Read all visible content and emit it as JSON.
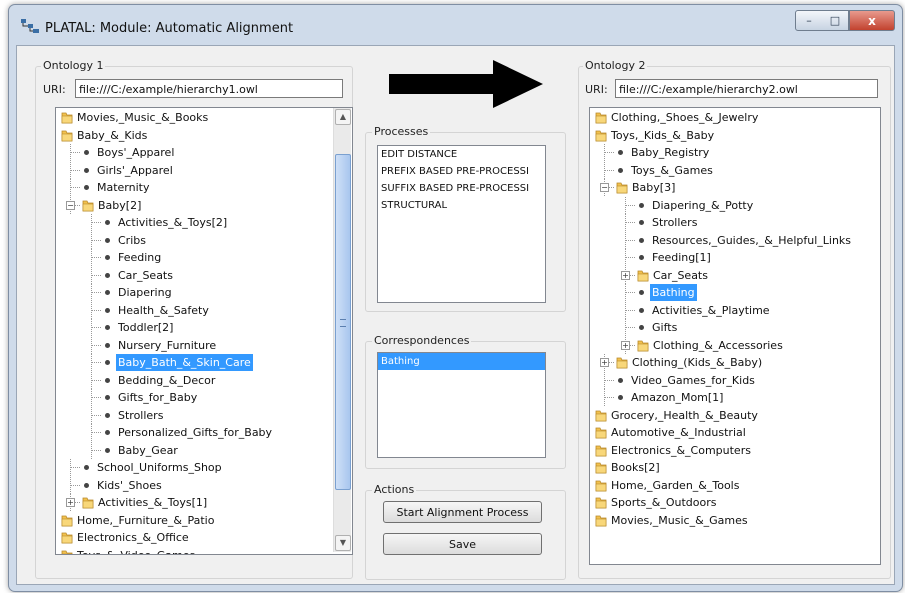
{
  "window": {
    "title": "PLATAL: Module: Automatic Alignment",
    "controls": {
      "minimize": "–",
      "maximize": "□",
      "close": "x"
    }
  },
  "ontology1": {
    "label": "Ontology 1",
    "uri_label": "URI:",
    "uri_value": "file:///C:/example/hierarchy1.owl",
    "tree": [
      {
        "label": "Movies,_Music_&_Books",
        "depth": 0,
        "kind": "folder"
      },
      {
        "label": "Baby_&_Kids",
        "depth": 0,
        "kind": "folder"
      },
      {
        "label": "Boys'_Apparel",
        "depth": 1,
        "kind": "leaf"
      },
      {
        "label": "Girls'_Apparel",
        "depth": 1,
        "kind": "leaf"
      },
      {
        "label": "Maternity",
        "depth": 1,
        "kind": "leaf"
      },
      {
        "label": "Baby[2]",
        "depth": 1,
        "kind": "folder",
        "expander": "−"
      },
      {
        "label": "Activities_&_Toys[2]",
        "depth": 2,
        "kind": "leaf"
      },
      {
        "label": "Cribs",
        "depth": 2,
        "kind": "leaf"
      },
      {
        "label": "Feeding",
        "depth": 2,
        "kind": "leaf"
      },
      {
        "label": "Car_Seats",
        "depth": 2,
        "kind": "leaf"
      },
      {
        "label": "Diapering",
        "depth": 2,
        "kind": "leaf"
      },
      {
        "label": "Health_&_Safety",
        "depth": 2,
        "kind": "leaf"
      },
      {
        "label": "Toddler[2]",
        "depth": 2,
        "kind": "leaf"
      },
      {
        "label": "Nursery_Furniture",
        "depth": 2,
        "kind": "leaf"
      },
      {
        "label": "Baby_Bath_&_Skin_Care",
        "depth": 2,
        "kind": "leaf",
        "selected": true
      },
      {
        "label": "Bedding_&_Decor",
        "depth": 2,
        "kind": "leaf"
      },
      {
        "label": "Gifts_for_Baby",
        "depth": 2,
        "kind": "leaf"
      },
      {
        "label": "Strollers",
        "depth": 2,
        "kind": "leaf"
      },
      {
        "label": "Personalized_Gifts_for_Baby",
        "depth": 2,
        "kind": "leaf"
      },
      {
        "label": "Baby_Gear",
        "depth": 2,
        "kind": "leaf"
      },
      {
        "label": "School_Uniforms_Shop",
        "depth": 1,
        "kind": "leaf"
      },
      {
        "label": "Kids'_Shoes",
        "depth": 1,
        "kind": "leaf"
      },
      {
        "label": "Activities_&_Toys[1]",
        "depth": 1,
        "kind": "folder",
        "expander": "+"
      },
      {
        "label": "Home,_Furniture_&_Patio",
        "depth": 0,
        "kind": "folder"
      },
      {
        "label": "Electronics_&_Office",
        "depth": 0,
        "kind": "folder"
      },
      {
        "label": "Toys_&_Video_Games",
        "depth": 0,
        "kind": "folder"
      }
    ]
  },
  "ontology2": {
    "label": "Ontology 2",
    "uri_label": "URI:",
    "uri_value": "file:///C:/example/hierarchy2.owl",
    "tree": [
      {
        "label": "Clothing,_Shoes_&_Jewelry",
        "depth": 0,
        "kind": "folder"
      },
      {
        "label": "Toys,_Kids_&_Baby",
        "depth": 0,
        "kind": "folder"
      },
      {
        "label": "Baby_Registry",
        "depth": 1,
        "kind": "leaf"
      },
      {
        "label": "Toys_&_Games",
        "depth": 1,
        "kind": "leaf"
      },
      {
        "label": "Baby[3]",
        "depth": 1,
        "kind": "folder",
        "expander": "−"
      },
      {
        "label": "Diapering_&_Potty",
        "depth": 2,
        "kind": "leaf"
      },
      {
        "label": "Strollers",
        "depth": 2,
        "kind": "leaf"
      },
      {
        "label": "Resources,_Guides,_&_Helpful_Links",
        "depth": 2,
        "kind": "leaf"
      },
      {
        "label": "Feeding[1]",
        "depth": 2,
        "kind": "leaf"
      },
      {
        "label": "Car_Seats",
        "depth": 2,
        "kind": "folder",
        "expander": "+"
      },
      {
        "label": "Bathing",
        "depth": 2,
        "kind": "leaf",
        "selected": true
      },
      {
        "label": "Activities_&_Playtime",
        "depth": 2,
        "kind": "leaf"
      },
      {
        "label": "Gifts",
        "depth": 2,
        "kind": "leaf"
      },
      {
        "label": "Clothing_&_Accessories",
        "depth": 2,
        "kind": "folder",
        "expander": "+"
      },
      {
        "label": "Clothing_(Kids_&_Baby)",
        "depth": 1,
        "kind": "folder",
        "expander": "+"
      },
      {
        "label": "Video_Games_for_Kids",
        "depth": 1,
        "kind": "leaf"
      },
      {
        "label": "Amazon_Mom[1]",
        "depth": 1,
        "kind": "leaf"
      },
      {
        "label": "Grocery,_Health_&_Beauty",
        "depth": 0,
        "kind": "folder"
      },
      {
        "label": "Automotive_&_Industrial",
        "depth": 0,
        "kind": "folder"
      },
      {
        "label": "Electronics_&_Computers",
        "depth": 0,
        "kind": "folder"
      },
      {
        "label": "Books[2]",
        "depth": 0,
        "kind": "folder"
      },
      {
        "label": "Home,_Garden_&_Tools",
        "depth": 0,
        "kind": "folder"
      },
      {
        "label": "Sports_&_Outdoors",
        "depth": 0,
        "kind": "folder"
      },
      {
        "label": "Movies,_Music_&_Games",
        "depth": 0,
        "kind": "folder"
      }
    ]
  },
  "processes": {
    "label": "Processes",
    "items": [
      "EDIT DISTANCE",
      "PREFIX BASED PRE-PROCESSI",
      "SUFFIX BASED PRE-PROCESSI",
      "STRUCTURAL"
    ]
  },
  "correspondences": {
    "label": "Correspondences",
    "items": [
      "Bathing"
    ]
  },
  "actions": {
    "label": "Actions",
    "start_label": "Start Alignment Process",
    "save_label": "Save"
  },
  "colors": {
    "selection": "#3399ff",
    "folder": "#f2c14e",
    "arrow": "#000000"
  }
}
